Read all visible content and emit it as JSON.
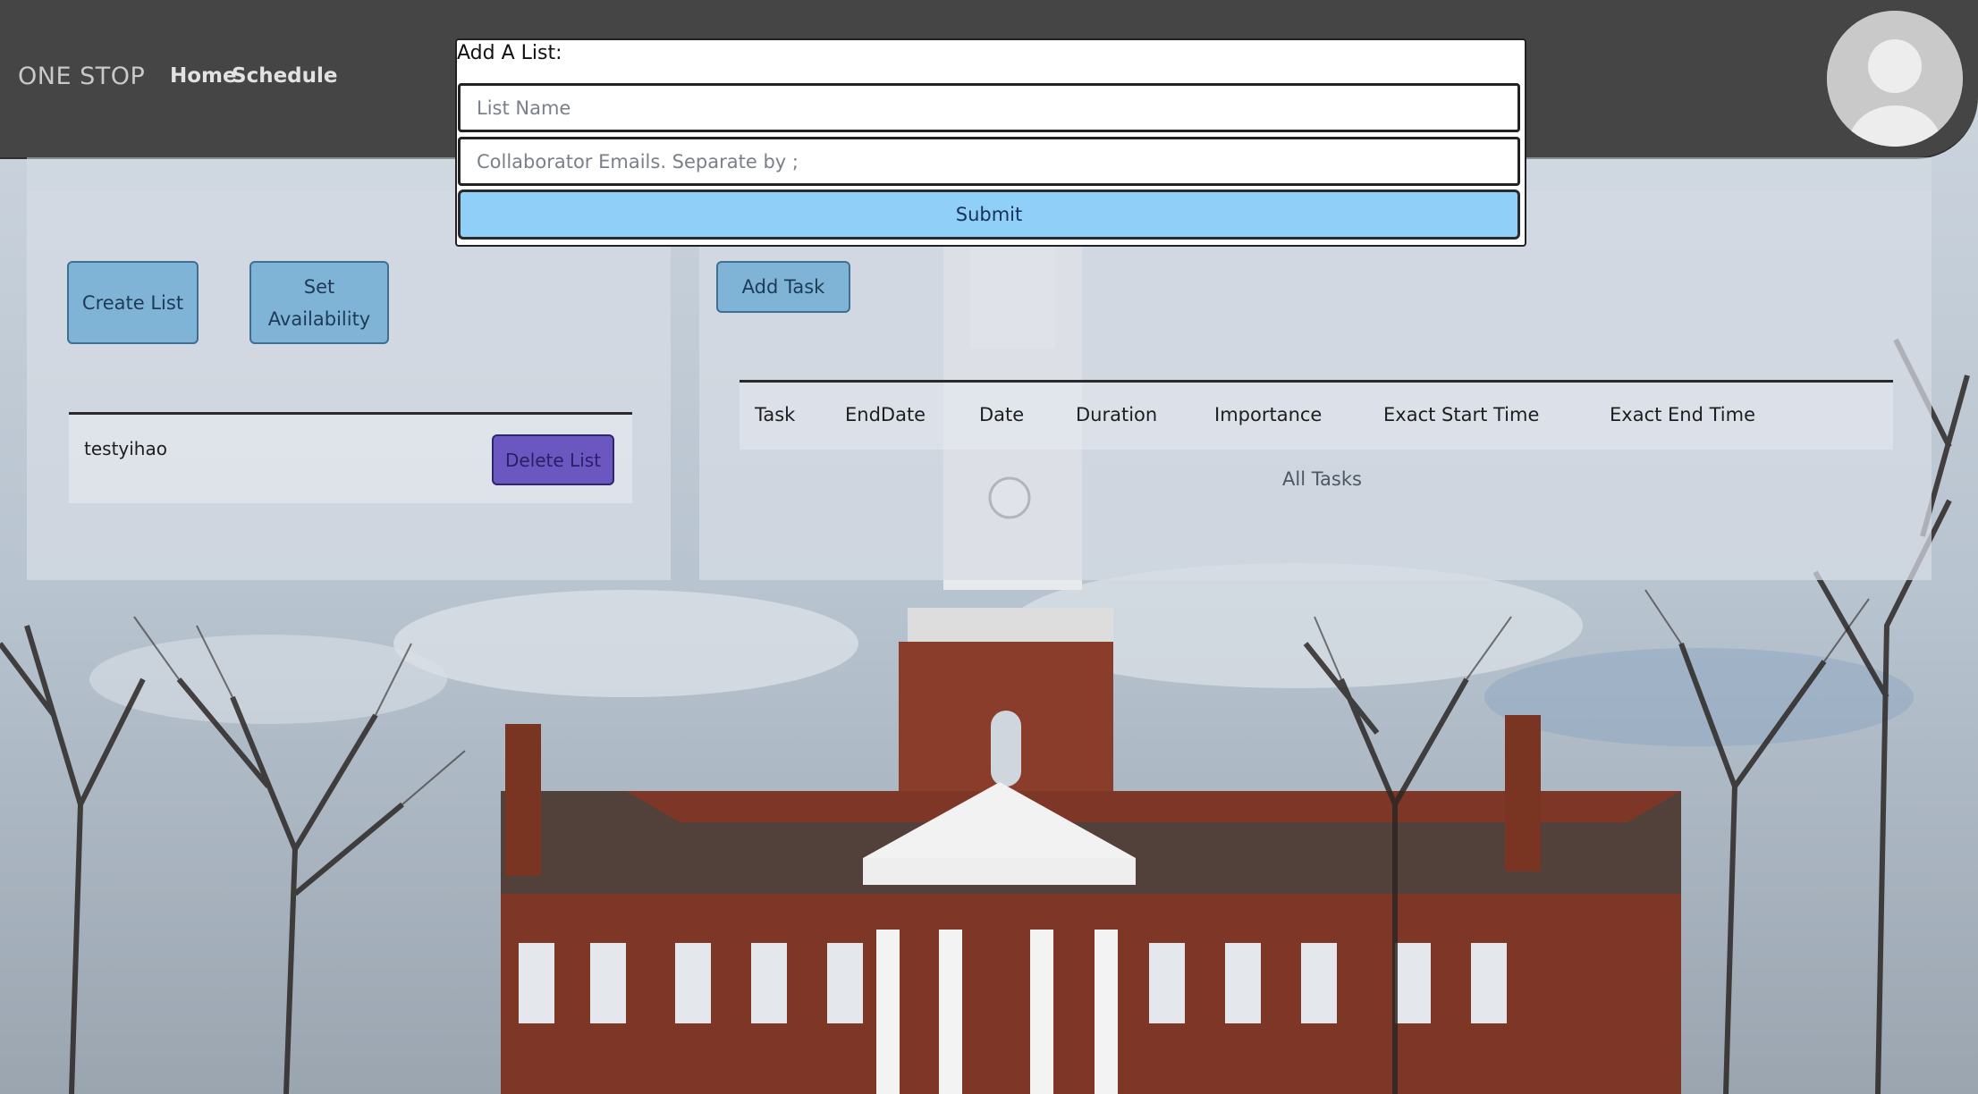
{
  "navbar": {
    "brand": "ONE STOP",
    "links": [
      {
        "label": "Home"
      },
      {
        "label": "Schedule"
      }
    ]
  },
  "sidebar": {
    "create_list_label": "Create List",
    "set_availability_label": "Set Availability",
    "lists": [
      {
        "name": "testyihao",
        "delete_label": "Delete List"
      }
    ]
  },
  "tasks": {
    "add_task_label": "Add Task",
    "columns": [
      "Task",
      "EndDate",
      "Date",
      "Duration",
      "Importance",
      "Exact Start Time",
      "Exact End Time"
    ],
    "empty_label": "All Tasks"
  },
  "modal": {
    "title": "Add A List:",
    "list_name_placeholder": "List Name",
    "emails_placeholder": "Collaborator Emails. Separate by ;",
    "submit_label": "Submit"
  },
  "colors": {
    "navbar": "#454545",
    "button_blue": "#7fb4d6",
    "delete_purple": "#6a58c0",
    "submit_blue": "#8fcff8"
  },
  "icons": {
    "avatar": "user-avatar-icon"
  }
}
